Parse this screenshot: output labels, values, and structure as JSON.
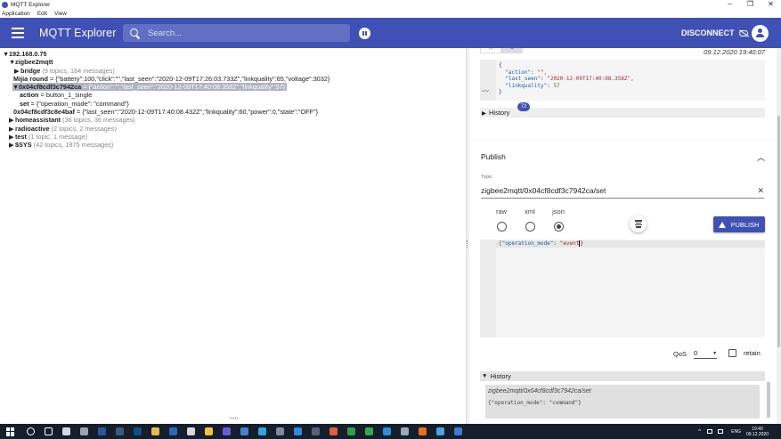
{
  "window": {
    "title": "MQTT Explorer",
    "controls": [
      "–",
      "❐",
      "✕"
    ]
  },
  "menu": [
    "Application",
    "Edit",
    "View"
  ],
  "appbar": {
    "title": "MQTT Explorer",
    "search_placeholder": "Search...",
    "disconnect_label": "DISCONNECT"
  },
  "tree": {
    "root": "192.168.0.75",
    "zigbee2mqtt": "zigbee2mqtt",
    "bridge": {
      "name": "bridge",
      "meta": "(9 topics, 184 messages)"
    },
    "mijia": {
      "name": "Mijia round",
      "value": " = {\"battery\":100,\"click\":\"\",\"last_seen\":\"2020-12-09T17:26:03.733Z\",\"linkquality\":65,\"voltage\":3032}"
    },
    "selected": {
      "name": "0x04cf8cdf3c7942ca",
      "value": " = {\"action\":\"\",\"last_seen\":\"2020-12-09T17:40:08.358Z\",\"linkquality\":57}"
    },
    "action": {
      "name": "action",
      "value": " = button_1_single"
    },
    "set": {
      "name": "set",
      "value": " = {\"operation_mode\": \"command\"}"
    },
    "other_device": {
      "name": "0x04cf8cdf3c8e4baf",
      "value": " = {\"last_seen\":\"2020-12-09T17:40:08.432Z\",\"linkquality\":60,\"power\":0,\"state\":\"OFF\"}"
    },
    "homeassistant": {
      "name": "homeassistant",
      "meta": "(36 topics, 36 messages)"
    },
    "radioactive": {
      "name": "radioactive",
      "meta": "(2 topics, 2 messages)"
    },
    "test": {
      "name": "test",
      "meta": "(1 topic, 1 message)"
    },
    "sys": {
      "name": "$SYS",
      "meta": "(42 topics, 1875 messages)"
    }
  },
  "message": {
    "date": "09.12.2020 19:40:07",
    "json_lines": {
      "open": "{",
      "action_key": "\"action\"",
      "action_val": "\"\",",
      "last_seen_key": "\"last_seen\"",
      "last_seen_val": "\"2020-12-09T17:40:08.358Z\",",
      "linkquality_key": "\"linkquality\"",
      "linkquality_val": "57",
      "close": "}"
    },
    "history_label": "History",
    "history_count": "72"
  },
  "publish": {
    "title": "Publish",
    "topic_label": "Topic",
    "topic_value": "zigbee2mqtt/0x04cf8cdf3c7942ca/set",
    "formats": [
      "raw",
      "xml",
      "json"
    ],
    "selected_format": "json",
    "publish_label": "PUBLISH",
    "editor_key": "{\"operation_mode\"",
    "editor_colon": ": ",
    "editor_val": "\"event",
    "editor_tail": "}",
    "qos_label": "QoS",
    "qos_value": "0",
    "retain_label": "retain",
    "history_label": "History",
    "history_topic": "zigbee2mqtt/0x04cf8cdf3c7942ca/set",
    "history_payload": "{\"operation_mode\": \"command\"}"
  },
  "taskbar": {
    "lang": "ENG",
    "time": "19:40",
    "date": "09.12.2020",
    "icon_colors": [
      "#1d6f42",
      "#7f8c9a",
      "#cfd8dc",
      "#9aa4ad",
      "#2b579a",
      "#3a5a78",
      "#0e4f86",
      "#e8b84a",
      "#2468c6",
      "#d5d8dc",
      "#f0c040",
      "#6b5bd6",
      "#4a7fd0",
      "#2fa6e0",
      "#7a8ba0",
      "#2d8cdb",
      "#56627a",
      "#e55b3c",
      "#2f9e44",
      "#36a84f",
      "#2b8fd8",
      "#9aa8bb",
      "#ef6c1a",
      "#4aa3df",
      "#3b7bd6"
    ]
  }
}
